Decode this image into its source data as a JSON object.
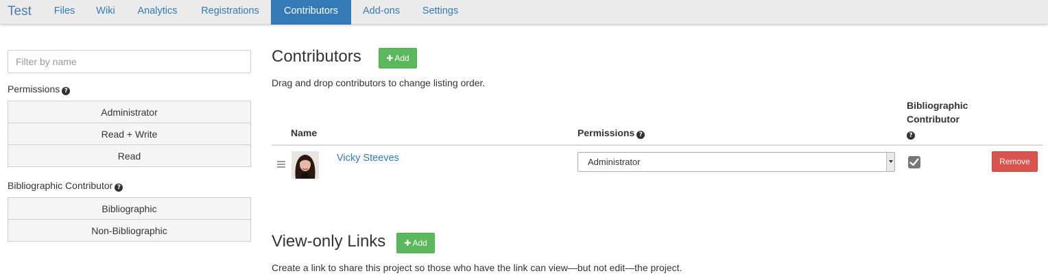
{
  "nav": {
    "brand": "Test",
    "tabs": [
      {
        "label": "Files"
      },
      {
        "label": "Wiki"
      },
      {
        "label": "Analytics"
      },
      {
        "label": "Registrations"
      },
      {
        "label": "Contributors"
      },
      {
        "label": "Add-ons"
      },
      {
        "label": "Settings"
      }
    ],
    "active_tab": "Contributors"
  },
  "sidebar": {
    "filter_placeholder": "Filter by name",
    "permissions_label": "Permissions",
    "permission_filters": [
      "Administrator",
      "Read + Write",
      "Read"
    ],
    "bib_label": "Bibliographic Contributor",
    "bib_filters": [
      "Bibliographic",
      "Non-Bibliographic"
    ]
  },
  "contributors": {
    "title": "Contributors",
    "add_label": "Add",
    "instructions": "Drag and drop contributors to change listing order.",
    "columns": {
      "name": "Name",
      "permissions": "Permissions",
      "bib_line1": "Bibliographic",
      "bib_line2": "Contributor"
    },
    "rows": [
      {
        "name": "Vicky Steeves",
        "permission": "Administrator",
        "bibliographic": true,
        "remove_label": "Remove"
      }
    ]
  },
  "view_only": {
    "title": "View-only Links",
    "add_label": "Add",
    "description": "Create a link to share this project so those who have the link can view—but not edit—the project."
  },
  "colors": {
    "nav_bg": "#ebebeb",
    "active_tab": "#337ab7",
    "link": "#337ab7",
    "add_green": "#5cb85c",
    "remove_red": "#d9534f"
  },
  "icons": [
    "plus-icon",
    "question-circle-icon",
    "drag-handle-icon",
    "check-icon",
    "caret-down-icon"
  ]
}
